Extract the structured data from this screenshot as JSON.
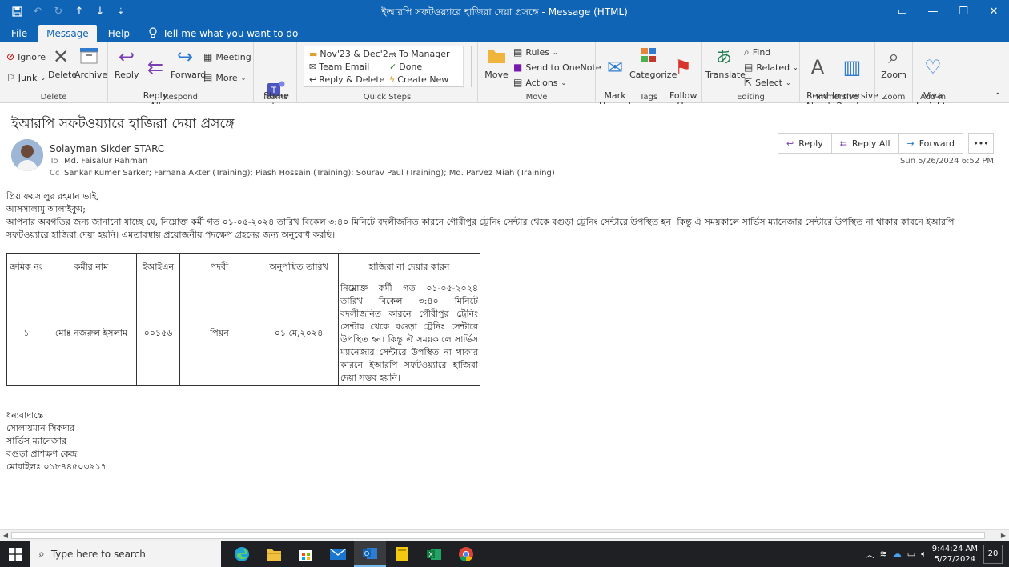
{
  "window": {
    "title": "ইআরপি সফটওয়্যারে হাজিরা দেয়া প্রসঙ্গে  -  Message (HTML)"
  },
  "menu": {
    "tabs": [
      "File",
      "Message",
      "Help"
    ],
    "tell_me": "Tell me what you want to do"
  },
  "ribbon": {
    "delete": {
      "ignore": "Ignore",
      "junk": "Junk",
      "delete": "Delete",
      "archive": "Archive",
      "label": "Delete"
    },
    "respond": {
      "reply": "Reply",
      "reply_all": "Reply\nAll",
      "forward": "Forward",
      "meeting": "Meeting",
      "more": "More",
      "label": "Respond"
    },
    "teams": {
      "share": "Share to\nTeams",
      "label": "Teams"
    },
    "quick_steps": {
      "items": [
        "Nov'23 & Dec'2...",
        "To Manager",
        "Team Email",
        "Done",
        "Reply & Delete",
        "Create New"
      ],
      "label": "Quick Steps"
    },
    "move": {
      "move": "Move",
      "rules": "Rules",
      "onenote": "Send to OneNote",
      "actions": "Actions",
      "label": "Move"
    },
    "tags": {
      "mark_unread": "Mark\nUnread",
      "categorize": "Categorize",
      "follow_up": "Follow\nUp",
      "label": "Tags"
    },
    "editing": {
      "translate": "Translate",
      "find": "Find",
      "related": "Related",
      "select": "Select",
      "label": "Editing"
    },
    "immersive": {
      "read_aloud": "Read\nAloud",
      "immersive_reader": "Immersive\nReader",
      "label": "Immersive"
    },
    "zoom": {
      "zoom": "Zoom",
      "label": "Zoom"
    },
    "addin": {
      "viva": "Viva\nInsights",
      "label": "Add-in"
    }
  },
  "message": {
    "subject": "ইআরপি সফটওয়্যারে হাজিরা দেয়া প্রসঙ্গে",
    "sender": "Solayman Sikder STARC",
    "to_label": "To",
    "to": "Md. Faisalur Rahman",
    "cc_label": "Cc",
    "cc": "Sankar  Kumer Sarker; Farhana Akter (Training); Piash Hossain (Training); Sourav Paul (Training); Md. Parvez Miah (Training)",
    "date": "Sun 5/26/2024 6:52 PM",
    "actions": {
      "reply": "Reply",
      "reply_all": "Reply All",
      "forward": "Forward"
    },
    "body": {
      "greeting": "প্রিয় ফয়সালুর রহমান ভাই,",
      "salam": "আসসালামু আলাইকুম;",
      "para": "আপনার অবগতির জন্য জানানো যাচ্ছে যে, নিম্নোক্ত কর্মী গত ০১-০৫-২০২৪ তারিখ বিকেল ৩:৪০ মিনিটে বদলীজনিত কারনে গৌরীপুর ট্রেনিং সেন্টার থেকে বগুড়া ট্রেনিং সেন্টারে উপস্থিত হন। কিন্তু ঐ সময়কালে সার্ভিস ম্যানেজার সেন্টারে উপস্থিত না থাকার কারনে ইআরপি সফটওয়্যারে হাজিরা দেয়া হয়নি। এমতাবস্থায় প্রয়োজনীয় পদক্ষেপ গ্রহনের জন্য অনুরোধ করছি।"
    },
    "table": {
      "headers": [
        "ক্রমিক নং",
        "কর্মীর নাম",
        "ইআইএন",
        "পদবী",
        "অনুপস্থিত তারিখ",
        "হাজিরা না দেয়ার কারন"
      ],
      "row": {
        "serial": "১",
        "name": "মোঃ নজরুল ইসলাম",
        "ein": "০০১৫৬",
        "designation": "পিয়ন",
        "date": "০১ মে,২০২৪",
        "reason": "নিম্নোক্ত কর্মী গত ০১-০৫-২০২৪ তারিখ বিকেল ৩:৪০ মিনিটে বদলীজনিত কারনে গৌরীপুর ট্রেনিং সেন্টার থেকে বগুড়া ট্রেনিং সেন্টারে উপস্থিত হন। কিন্তু ঐ সময়কালে সার্ভিস ম্যানেজার সেন্টারে উপস্থিত না থাকার কারনে ইআরপি সফটওয়্যারে হাজিরা দেয়া সম্ভব হয়নি।"
      }
    },
    "signature": [
      "ধন্যবাদান্তে",
      "সোলায়মান সিকদার",
      "সার্ভিস ম্যানেজার",
      "বগুড়া প্রশিক্ষণ কেন্দ্র",
      "মোবাইলঃ ০১৮৪৪৫০৩৯১৭"
    ]
  },
  "taskbar": {
    "search_placeholder": "Type here to search",
    "time": "9:44:24 AM",
    "date": "5/27/2024",
    "notifications": "20"
  },
  "colors": {
    "accent": "#0f64b5",
    "taskbar": "#1f2023"
  }
}
